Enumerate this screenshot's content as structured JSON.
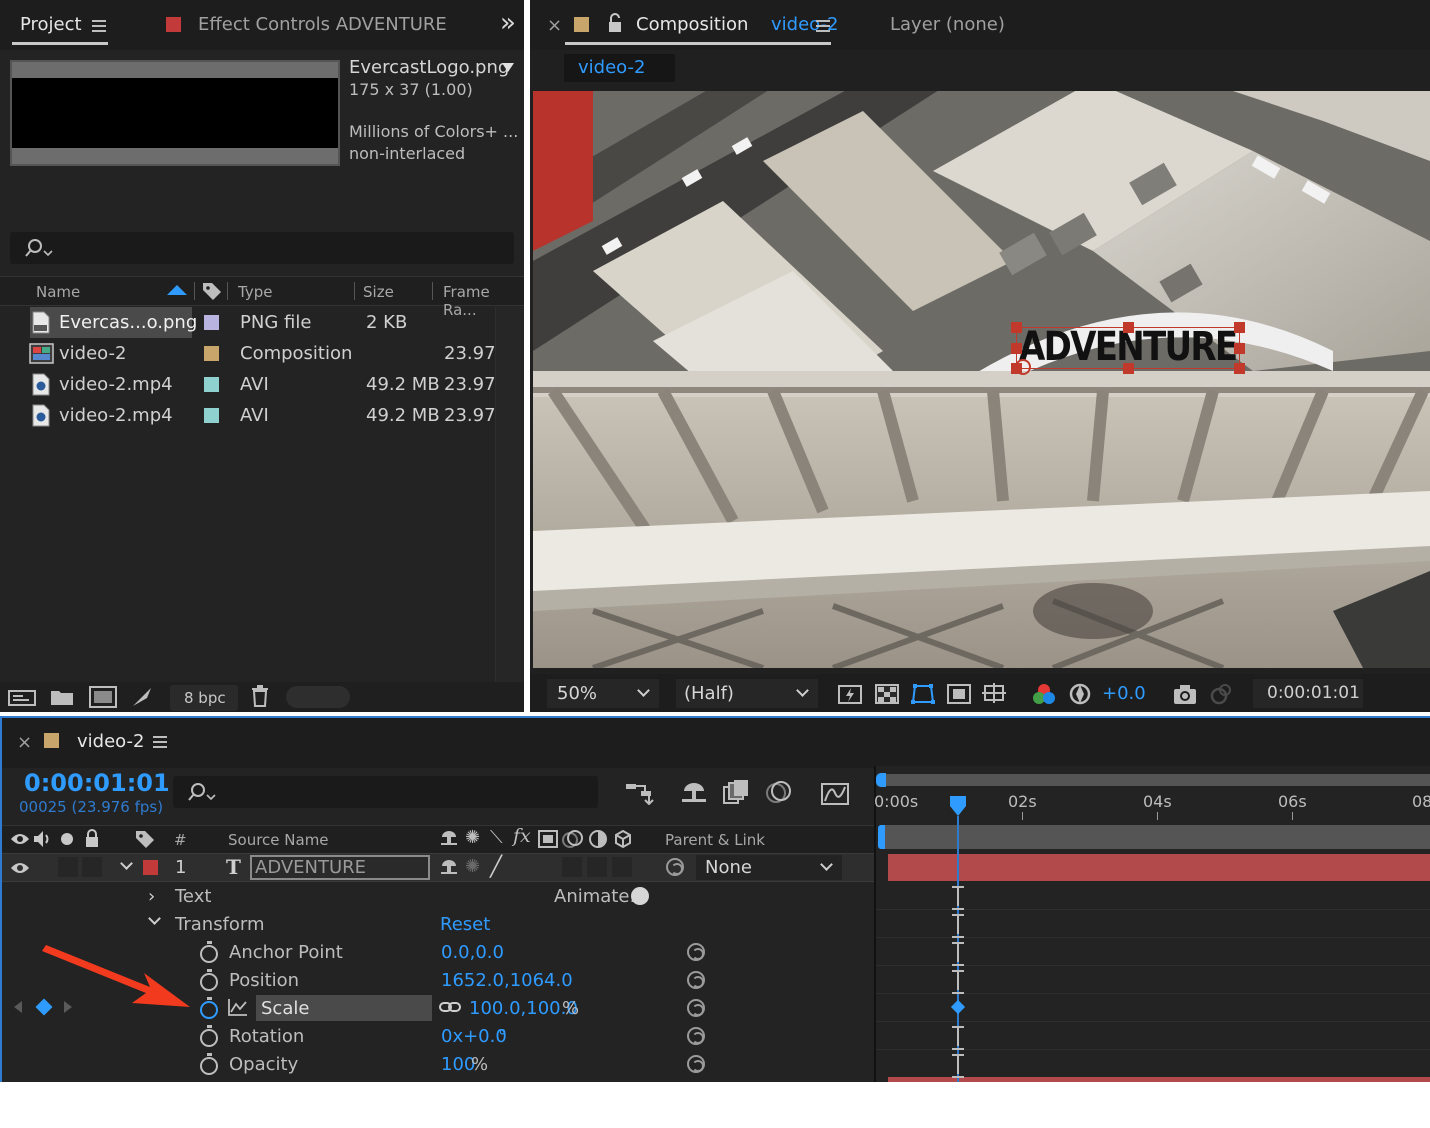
{
  "project_panel": {
    "tab_project": "Project",
    "tab_effect_controls": "Effect Controls ADVENTURE",
    "overflow": "»",
    "preview": {
      "filename": "EvercastLogo.png",
      "dimensions": "175 x 37 (1.00)",
      "colors": "Millions of Colors+ ...",
      "interlace": "non-interlaced"
    },
    "search_placeholder": "",
    "columns": {
      "name": "Name",
      "type": "Type",
      "size": "Size",
      "frame_rate": "Frame Ra..."
    },
    "items": [
      {
        "name": "Evercas...o.png",
        "type": "PNG file",
        "size": "2 KB",
        "frame_rate": "",
        "label_color": "#b9b3e0",
        "icon": "png-file-icon"
      },
      {
        "name": "video-2",
        "type": "Composition",
        "size": "",
        "frame_rate": "23.976",
        "label_color": "#c7a56b",
        "icon": "composition-icon"
      },
      {
        "name": "video-2.mp4",
        "type": "AVI",
        "size": "49.2 MB",
        "frame_rate": "23.976",
        "label_color": "#8fd1cf",
        "icon": "video-file-icon"
      },
      {
        "name": "video-2.mp4",
        "type": "AVI",
        "size": "49.2 MB",
        "frame_rate": "23.976",
        "label_color": "#8fd1cf",
        "icon": "video-file-icon"
      }
    ],
    "bpc": "8 bpc"
  },
  "comp_panel": {
    "close": "×",
    "tab_prefix": "Composition",
    "tab_comp": "video-2",
    "tab_layer": "Layer (none)",
    "flowchart_tab": "video-2",
    "overlay_text": "ADVENTURE",
    "zoom": "50%",
    "resolution": "(Half)",
    "exposure": "+0.0",
    "timecode": "0:00:01:01"
  },
  "timeline": {
    "close": "×",
    "comp_name": "video-2",
    "timecode": "0:00:01:01",
    "frames": "00025 (23.976 fps)",
    "search_placeholder": "",
    "col_hash": "#",
    "col_source": "Source Name",
    "col_parent": "Parent & Link",
    "ruler": [
      "0:00s",
      "02s",
      "04s",
      "06s",
      "08"
    ],
    "layer": {
      "number": "1",
      "type_glyph": "T",
      "name": "ADVENTURE",
      "parent": "None",
      "label_color": "#c23a3a"
    },
    "text_group": "Text",
    "animate_label": "Animate:",
    "transform_group": "Transform",
    "reset": "Reset",
    "properties": [
      {
        "name": "Anchor Point",
        "value": "0.0,0.0"
      },
      {
        "name": "Position",
        "value": "1652.0,1064.0"
      },
      {
        "name": "Scale",
        "value": "100.0,100.0",
        "suffix": "%"
      },
      {
        "name": "Rotation",
        "value": "0x+0.0",
        "suffix": "°"
      },
      {
        "name": "Opacity",
        "value": "100",
        "suffix": "%"
      }
    ]
  },
  "colors": {
    "accent": "#2f9bff",
    "arrow": "#f23b1e",
    "layer_bar": "#b24a4c"
  }
}
